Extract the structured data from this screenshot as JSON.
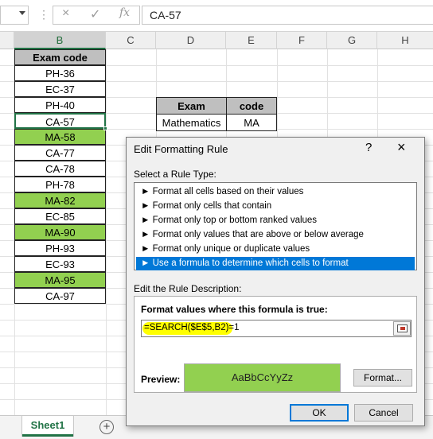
{
  "formula_bar": {
    "name_box": "",
    "cancel_icon": "×",
    "enter_icon": "✓",
    "fx_label": "fx",
    "value": "CA-57"
  },
  "columns": [
    "B",
    "C",
    "D",
    "E",
    "F",
    "G",
    "H"
  ],
  "selected_column": "B",
  "exam_code_column": {
    "header": "Exam code",
    "rows": [
      {
        "value": "PH-36",
        "highlighted": false
      },
      {
        "value": "EC-37",
        "highlighted": false
      },
      {
        "value": "PH-40",
        "highlighted": false
      },
      {
        "value": "CA-57",
        "highlighted": false,
        "active": true
      },
      {
        "value": "MA-58",
        "highlighted": true
      },
      {
        "value": "CA-77",
        "highlighted": false
      },
      {
        "value": "CA-78",
        "highlighted": false
      },
      {
        "value": "PH-78",
        "highlighted": false
      },
      {
        "value": "MA-82",
        "highlighted": true
      },
      {
        "value": "EC-85",
        "highlighted": false
      },
      {
        "value": "MA-90",
        "highlighted": true
      },
      {
        "value": "PH-93",
        "highlighted": false
      },
      {
        "value": "EC-93",
        "highlighted": false
      },
      {
        "value": "MA-95",
        "highlighted": true
      },
      {
        "value": "CA-97",
        "highlighted": false
      }
    ]
  },
  "lookup_table": {
    "headers": [
      "Exam",
      "code"
    ],
    "row": [
      "Mathematics",
      "MA"
    ]
  },
  "sheet_tabs": {
    "active": "Sheet1",
    "add_icon": "+"
  },
  "dialog": {
    "title": "Edit Formatting Rule",
    "help": "?",
    "close": "×",
    "select_rule_type_label": "Select a Rule Type:",
    "rule_types": [
      "Format all cells based on their values",
      "Format only cells that contain",
      "Format only top or bottom ranked values",
      "Format only values that are above or below average",
      "Format only unique or duplicate values",
      "Use a formula to determine which cells to format"
    ],
    "selected_rule_index": 5,
    "rule_bullet": "►",
    "edit_description_label": "Edit the Rule Description:",
    "formula_heading": "Format values where this formula is true:",
    "formula": "=SEARCH($E$5,B2)=1",
    "preview_label": "Preview:",
    "preview_text": "AaBbCcYyZz",
    "format_button": "Format...",
    "ok_button": "OK",
    "cancel_button": "Cancel"
  },
  "colors": {
    "highlight": "#92d050",
    "header_fill": "#bfbfbf",
    "excel_green": "#217346",
    "selection_blue": "#0078d7",
    "formula_highlight": "#ffff00"
  }
}
